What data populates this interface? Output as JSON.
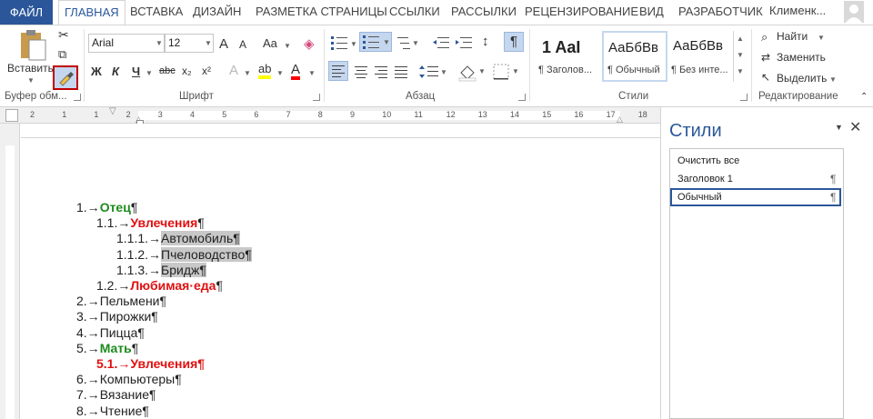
{
  "tabs": {
    "file": "ФАЙЛ",
    "items": [
      "ГЛАВНАЯ",
      "ВСТАВКА",
      "ДИЗАЙН",
      "РАЗМЕТКА СТРАНИЦЫ",
      "ССЫЛКИ",
      "РАССЫЛКИ",
      "РЕЦЕНЗИРОВАНИЕ",
      "ВИД",
      "РАЗРАБОТЧИК"
    ],
    "account": "Клименк..."
  },
  "clipboard": {
    "paste_label": "Вставить",
    "group_label": "Буфер обм..."
  },
  "font": {
    "name": "Arial",
    "size": "12",
    "group_label": "Шрифт",
    "grow": "A",
    "shrink": "A",
    "case": "Aa",
    "bold": "Ж",
    "italic": "К",
    "underline": "Ч",
    "strike": "abc",
    "subscript": "x₂",
    "superscript": "x²",
    "effects": "A",
    "highlight": "ab",
    "color": "A"
  },
  "paragraph": {
    "group_label": "Абзац",
    "pilcrow": "¶",
    "sort": "↕"
  },
  "styles": {
    "group_label": "Стили",
    "gallery": [
      {
        "preview": "1  AaI",
        "name": "¶ Заголов..."
      },
      {
        "preview": "АаБбВв",
        "name": "¶ Обычный"
      },
      {
        "preview": "АаБбВв",
        "name": "¶ Без инте..."
      }
    ]
  },
  "editing": {
    "group_label": "Редактирование",
    "find": "Найти",
    "replace": "Заменить",
    "select": "Выделить"
  },
  "document": {
    "lines": [
      {
        "num": "1.→",
        "text": "Отец",
        "style": "g",
        "mark": "¶"
      },
      {
        "num": "1.1.→",
        "text": "Увлечения",
        "style": "r",
        "mark": "¶"
      },
      {
        "num": "1.1.1.→",
        "text": "Автомобиль¶",
        "style": "hl",
        "mark": ""
      },
      {
        "num": "1.1.2.→",
        "text": "Пчеловодство¶",
        "style": "hl",
        "mark": ""
      },
      {
        "num": "1.1.3.→",
        "text": "Бридж¶",
        "style": "hl",
        "mark": ""
      },
      {
        "num": "1.2.→",
        "text": "Любимая·еда",
        "style": "r",
        "mark": "¶"
      },
      {
        "num": "2.→",
        "text": "Пельмени",
        "style": "",
        "mark": "¶"
      },
      {
        "num": "3.→",
        "text": "Пирожки",
        "style": "",
        "mark": "¶"
      },
      {
        "num": "4.→",
        "text": "Пицца",
        "style": "",
        "mark": "¶"
      },
      {
        "num": "5.→",
        "text": "Мать",
        "style": "g",
        "mark": "¶"
      },
      {
        "num": "5.1.→",
        "text": "Увлечения¶",
        "style": "rnum",
        "mark": ""
      },
      {
        "num": "6.→",
        "text": "Компьютеры",
        "style": "",
        "mark": "¶"
      },
      {
        "num": "7.→",
        "text": "Вязание",
        "style": "",
        "mark": "¶"
      },
      {
        "num": "8.→",
        "text": "Чтение",
        "style": "",
        "mark": "¶"
      }
    ]
  },
  "ruler": {
    "ticks": [
      "2",
      "1",
      "1",
      "2",
      "3",
      "4",
      "5",
      "6",
      "7",
      "8",
      "9",
      "10",
      "11",
      "12",
      "13",
      "14",
      "15",
      "16",
      "17",
      "18"
    ]
  },
  "styles_pane": {
    "title": "Стили",
    "items": [
      {
        "label": "Очистить все",
        "mark": ""
      },
      {
        "label": "Заголовок 1",
        "mark": "¶"
      },
      {
        "label": "Обычный",
        "mark": "¶"
      }
    ]
  },
  "colors": {
    "accent": "#2b579a",
    "green": "#1c8c1c",
    "red": "#e01010"
  }
}
